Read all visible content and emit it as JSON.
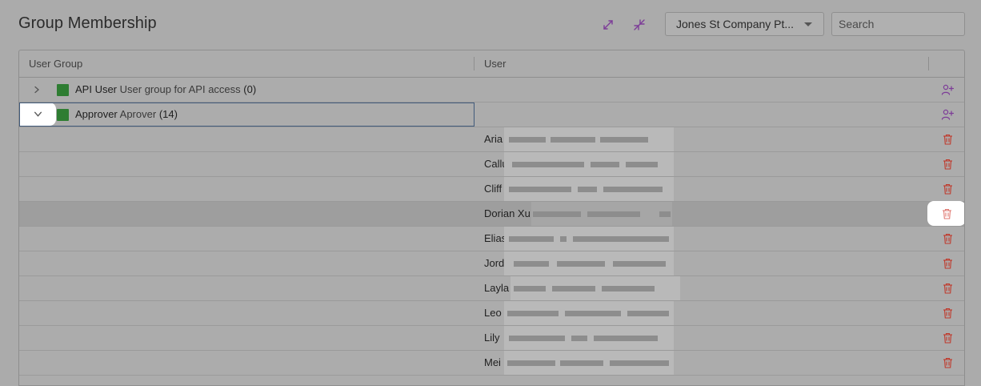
{
  "header": {
    "title": "Group Membership",
    "company_select": {
      "value": "Jones St Company Pt..."
    },
    "search": {
      "placeholder": "Search",
      "value": ""
    },
    "icons": [
      "expand-all-icon",
      "collapse-all-icon"
    ]
  },
  "grid": {
    "columns": {
      "user_group": "User Group",
      "user": "User"
    },
    "groups": [
      {
        "name": "API User",
        "description": "User group for API access",
        "count": "(0)",
        "expanded": false,
        "color": "#2e7d32"
      },
      {
        "name": "Approver",
        "description": "Aprover",
        "count": "(14)",
        "expanded": true,
        "color": "#2e7d32"
      }
    ],
    "users": [
      {
        "name": "Aria"
      },
      {
        "name": "Callu"
      },
      {
        "name": "Cliff"
      },
      {
        "name": "Dorian Xu"
      },
      {
        "name": "Elias"
      },
      {
        "name": "Jord"
      },
      {
        "name": "Layla"
      },
      {
        "name": "Leo"
      },
      {
        "name": "Lily"
      },
      {
        "name": "Mei"
      }
    ]
  },
  "colors": {
    "accent": "#8e44ad",
    "delete": "#c0392b",
    "group_swatch": "#2e7d32"
  }
}
